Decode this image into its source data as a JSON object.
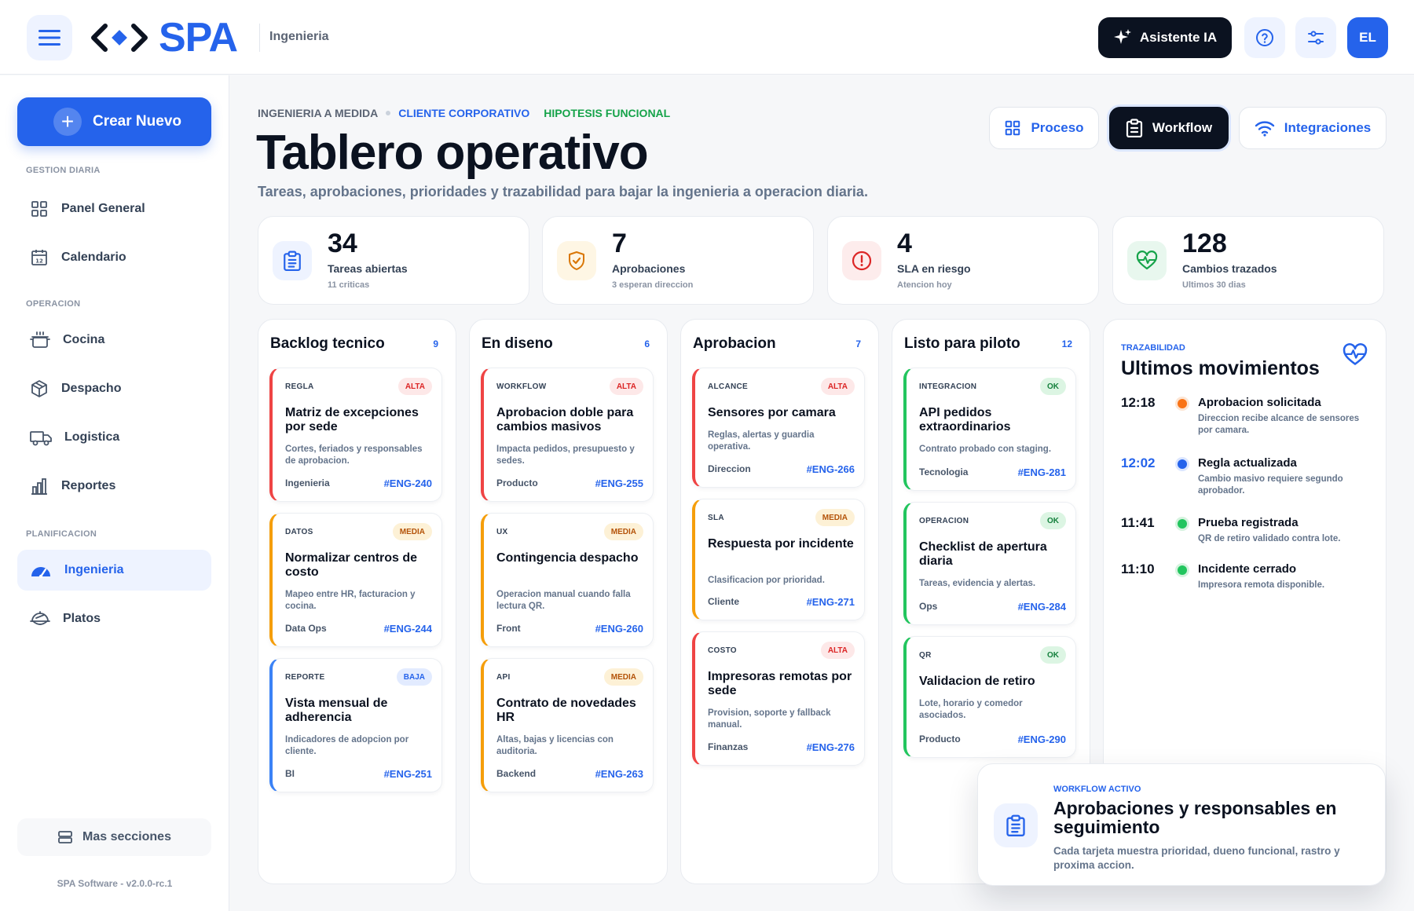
{
  "header": {
    "logo_text": "SPA",
    "section": "Ingenieria",
    "ai_button": "Asistente IA",
    "avatar_initials": "EL"
  },
  "sidebar": {
    "create_button": "Crear Nuevo",
    "groups": [
      {
        "heading": "GESTION DIARIA",
        "items": [
          {
            "label": "Panel General",
            "icon": "grid-icon"
          },
          {
            "label": "Calendario",
            "icon": "calendar-icon"
          }
        ]
      },
      {
        "heading": "OPERACION",
        "items": [
          {
            "label": "Cocina",
            "icon": "pot-icon"
          },
          {
            "label": "Despacho",
            "icon": "box-icon"
          },
          {
            "label": "Logistica",
            "icon": "truck-icon"
          },
          {
            "label": "Reportes",
            "icon": "bar-chart-icon"
          }
        ]
      },
      {
        "heading": "PLANIFICACION",
        "items": [
          {
            "label": "Ingenieria",
            "icon": "speedometer-icon",
            "active": true
          },
          {
            "label": "Platos",
            "icon": "dish-icon"
          }
        ]
      }
    ],
    "more_sections": "Mas secciones",
    "version": "SPA Software - v2.0.0-rc.1"
  },
  "breadcrumb": [
    "INGENIERIA A MEDIDA",
    "CLIENTE CORPORATIVO",
    "HIPOTESIS FUNCIONAL"
  ],
  "page": {
    "title": "Tablero operativo",
    "subtitle": "Tareas, aprobaciones, prioridades y trazabilidad para bajar la ingenieria a operacion diaria."
  },
  "view_tabs": [
    {
      "label": "Proceso",
      "icon": "grid-icon",
      "active": false
    },
    {
      "label": "Workflow",
      "icon": "clipboard-icon",
      "active": true
    },
    {
      "label": "Integraciones",
      "icon": "wifi-icon",
      "active": false
    }
  ],
  "stats": [
    {
      "value": "34",
      "label": "Tareas abiertas",
      "note": "11 criticas",
      "icon": "clipboard-icon",
      "color": "#2563eb",
      "bg": "#eef3ff"
    },
    {
      "value": "7",
      "label": "Aprobaciones",
      "note": "3 esperan direccion",
      "icon": "shield-check-icon",
      "color": "#d97706",
      "bg": "#fef6e4"
    },
    {
      "value": "4",
      "label": "SLA en riesgo",
      "note": "Atencion hoy",
      "icon": "alert-circle-icon",
      "color": "#dc2626",
      "bg": "#fdecec"
    },
    {
      "value": "128",
      "label": "Cambios trazados",
      "note": "Ultimos 30 dias",
      "icon": "heart-pulse-icon",
      "color": "#16a34a",
      "bg": "#e8f7ee"
    }
  ],
  "columns": [
    {
      "title": "Backlog tecnico",
      "count": "9",
      "cards": [
        {
          "tag": "REGLA",
          "priority": "ALTA",
          "title": "Matriz de excepciones por sede",
          "desc": "Cortes, feriados y responsables de aprobacion.",
          "owner": "Ingenieria",
          "id": "#ENG-240"
        },
        {
          "tag": "DATOS",
          "priority": "MEDIA",
          "title": "Normalizar centros de costo",
          "desc": "Mapeo entre HR, facturacion y cocina.",
          "owner": "Data Ops",
          "id": "#ENG-244"
        },
        {
          "tag": "REPORTE",
          "priority": "BAJA",
          "title": "Vista mensual de adherencia",
          "desc": "Indicadores de adopcion por cliente.",
          "owner": "BI",
          "id": "#ENG-251"
        }
      ]
    },
    {
      "title": "En diseno",
      "count": "6",
      "cards": [
        {
          "tag": "WORKFLOW",
          "priority": "ALTA",
          "title": "Aprobacion doble para cambios masivos",
          "desc": "Impacta pedidos, presupuesto y sedes.",
          "owner": "Producto",
          "id": "#ENG-255"
        },
        {
          "tag": "UX",
          "priority": "MEDIA",
          "title": "Contingencia despacho",
          "desc": "Operacion manual cuando falla lectura QR.",
          "owner": "Front",
          "id": "#ENG-260"
        },
        {
          "tag": "API",
          "priority": "MEDIA",
          "title": "Contrato de novedades HR",
          "desc": "Altas, bajas y licencias con auditoria.",
          "owner": "Backend",
          "id": "#ENG-263"
        }
      ]
    },
    {
      "title": "Aprobacion",
      "count": "7",
      "cards": [
        {
          "tag": "ALCANCE",
          "priority": "ALTA",
          "title": "Sensores por camara",
          "desc": "Reglas, alertas y guardia operativa.",
          "owner": "Direccion",
          "id": "#ENG-266"
        },
        {
          "tag": "SLA",
          "priority": "MEDIA",
          "title": "Respuesta por incidente",
          "desc": "Clasificacion por prioridad.",
          "owner": "Cliente",
          "id": "#ENG-271"
        },
        {
          "tag": "COSTO",
          "priority": "ALTA",
          "title": "Impresoras remotas por sede",
          "desc": "Provision, soporte y fallback manual.",
          "owner": "Finanzas",
          "id": "#ENG-276"
        }
      ]
    },
    {
      "title": "Listo para piloto",
      "count": "12",
      "cards": [
        {
          "tag": "INTEGRACION",
          "priority": "OK",
          "title": "API pedidos extraordinarios",
          "desc": "Contrato probado con staging.",
          "owner": "Tecnologia",
          "id": "#ENG-281"
        },
        {
          "tag": "OPERACION",
          "priority": "OK",
          "title": "Checklist de apertura diaria",
          "desc": "Tareas, evidencia y alertas.",
          "owner": "Ops",
          "id": "#ENG-284"
        },
        {
          "tag": "QR",
          "priority": "OK",
          "title": "Validacion de retiro",
          "desc": "Lote, horario y comedor asociados.",
          "owner": "Producto",
          "id": "#ENG-290"
        }
      ]
    }
  ],
  "trace": {
    "kicker": "TRAZABILIDAD",
    "title": "Ultimos movimientos",
    "movements": [
      {
        "time": "12:18",
        "title": "Aprobacion solicitada",
        "desc": "Direccion recibe alcance de sensores por camara.",
        "color": "#f97316"
      },
      {
        "time": "12:02",
        "title": "Regla actualizada",
        "desc": "Cambio masivo requiere segundo aprobador.",
        "color": "#2563eb"
      },
      {
        "time": "11:41",
        "title": "Prueba registrada",
        "desc": "QR de retiro validado contra lote.",
        "color": "#22c55e"
      },
      {
        "time": "11:10",
        "title": "Incidente cerrado",
        "desc": "Impresora remota disponible.",
        "color": "#22c55e"
      }
    ]
  },
  "workflow_card": {
    "kicker": "WORKFLOW ACTIVO",
    "title": "Aprobaciones y responsables en seguimiento",
    "desc": "Cada tarjeta muestra prioridad, dueno funcional, rastro y proxima accion."
  }
}
